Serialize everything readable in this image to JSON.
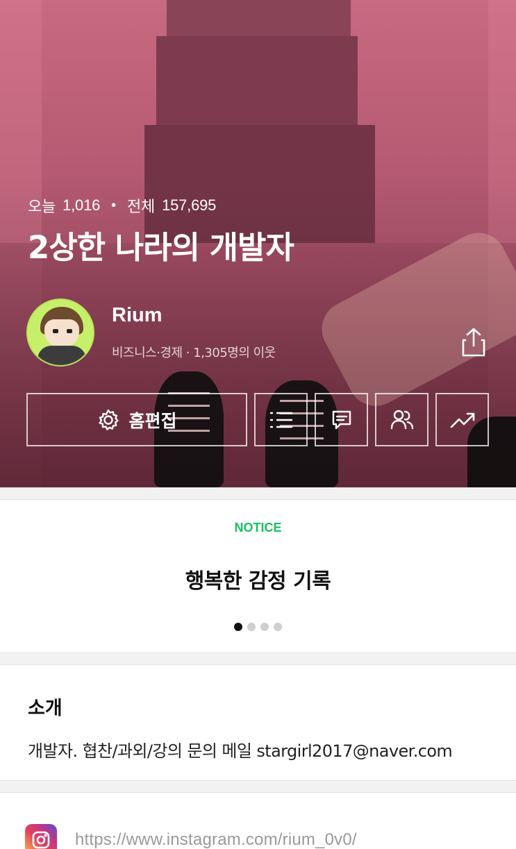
{
  "hero": {
    "stats": {
      "today_label": "오늘",
      "today_count": "1,016",
      "separator": "•",
      "total_label": "전체",
      "total_count": "157,695"
    },
    "blog_title": "2상한 나라의 개발자",
    "profile": {
      "username": "Rium",
      "meta": "비즈니스·경제 · 1,305명의 이웃"
    },
    "actions": {
      "edit_label": "홈편집"
    }
  },
  "notice": {
    "label": "NOTICE",
    "title": "행복한 감정 기록",
    "pages": 4,
    "active_page": 1
  },
  "intro": {
    "heading": "소개",
    "text": "개발자. 협찬/과외/강의 문의 메일 stargirl2017@naver.com"
  },
  "links": {
    "instagram_url": "https://www.instagram.com/rium_0v0/"
  },
  "colors": {
    "accent_green": "#19c060",
    "hero_tint": "#b55a72"
  }
}
